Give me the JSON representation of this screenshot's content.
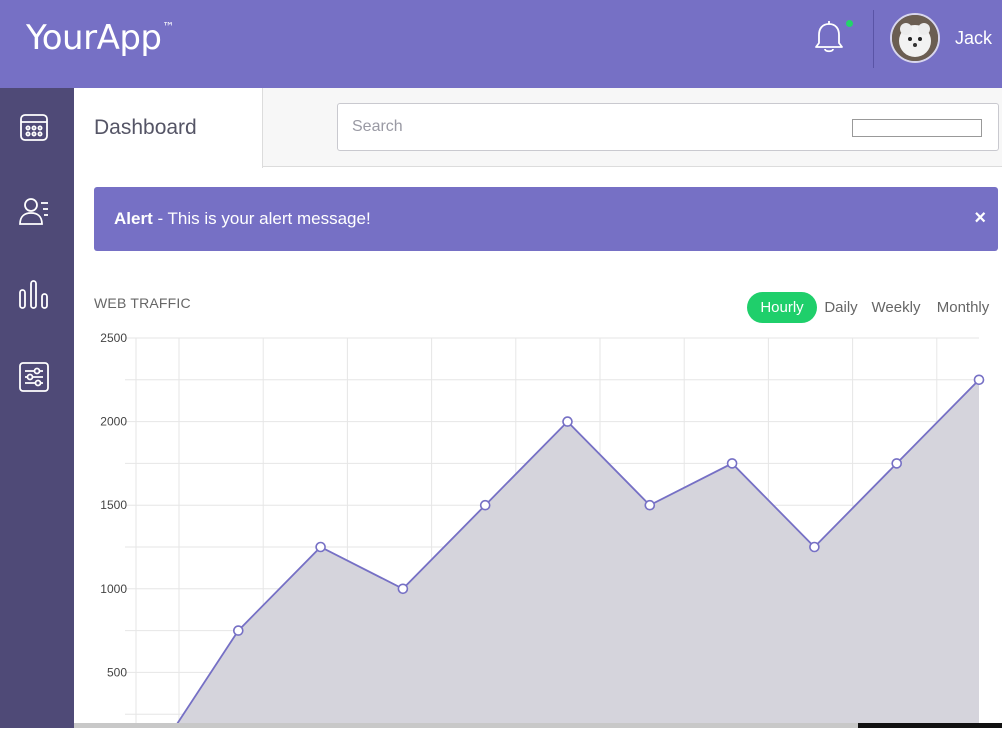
{
  "header": {
    "brand": "YourApp",
    "trademark": "™",
    "notification_icon": "bell-icon",
    "user_name": "Jack",
    "accent_color": "#7670c5",
    "notification_dot_color": "#22d46a"
  },
  "sidebar": {
    "background": "#4f4a77",
    "items": [
      {
        "icon": "calendar-icon"
      },
      {
        "icon": "users-list-icon"
      },
      {
        "icon": "bar-chart-icon"
      },
      {
        "icon": "sliders-icon"
      }
    ]
  },
  "subheader": {
    "title": "Dashboard",
    "search_placeholder": "Search"
  },
  "alert": {
    "title": "Alert",
    "message": " - This is your alert message!",
    "close": "×"
  },
  "traffic": {
    "title": "WEB TRAFFIC",
    "periods": [
      "Hourly",
      "Daily",
      "Weekly",
      "Monthly"
    ],
    "active_period": "Hourly",
    "active_color": "#1fcf6b"
  },
  "chart_data": {
    "type": "area",
    "title": "WEB TRAFFIC",
    "xlabel": "",
    "ylabel": "",
    "y_ticks": [
      500,
      1000,
      1500,
      2000,
      2500
    ],
    "ylim": [
      0,
      2500
    ],
    "grid": true,
    "line_color": "#7670c5",
    "fill_color": "#d5d4dc",
    "series": [
      {
        "values": [
          0,
          750,
          1250,
          1000,
          1500,
          2000,
          1500,
          1750,
          1250,
          1750,
          2250
        ]
      }
    ]
  }
}
